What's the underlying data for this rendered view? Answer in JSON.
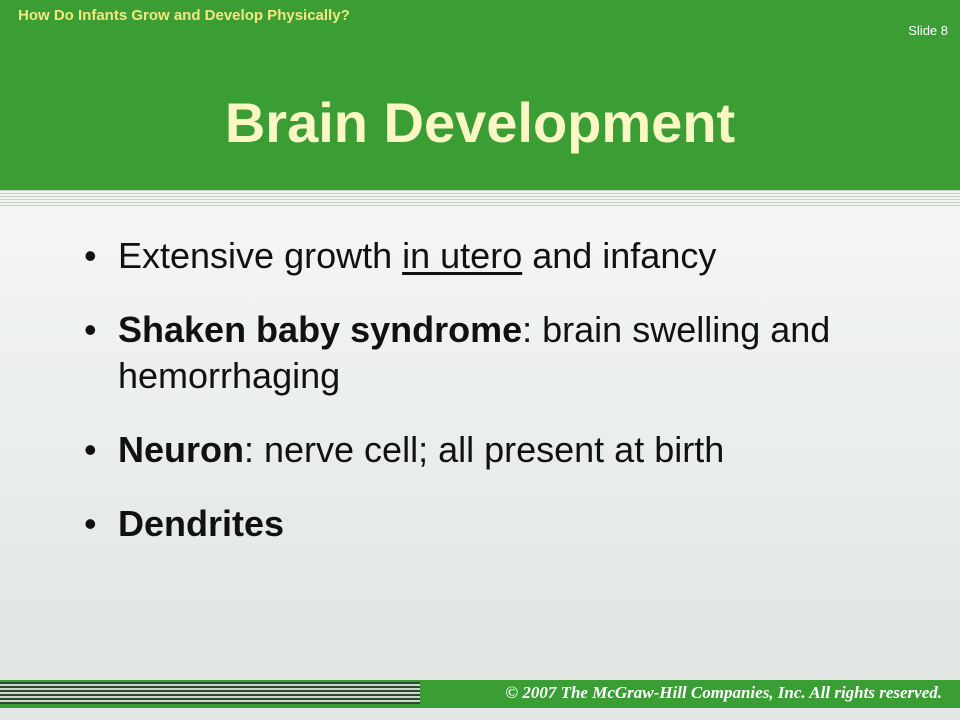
{
  "header": {
    "subtitle": "How Do Infants Grow and Develop Physically?",
    "slide_number": "Slide 8",
    "title": "Brain Development"
  },
  "bullets": [
    {
      "pre": "Extensive growth ",
      "underlined": "in utero",
      "post": " and infancy"
    },
    {
      "term": "Shaken baby syndrome",
      "rest": ": brain swelling and hemorrhaging"
    },
    {
      "term": "Neuron",
      "rest": ": nerve cell; all present at birth"
    },
    {
      "term": "Dendrites"
    }
  ],
  "footer": {
    "copyright": "© 2007 The McGraw-Hill Companies, Inc. All rights reserved."
  },
  "colors": {
    "header_green": "#3a9e35",
    "title_text": "#fbf7c4",
    "subtitle_text": "#f5e77e"
  }
}
